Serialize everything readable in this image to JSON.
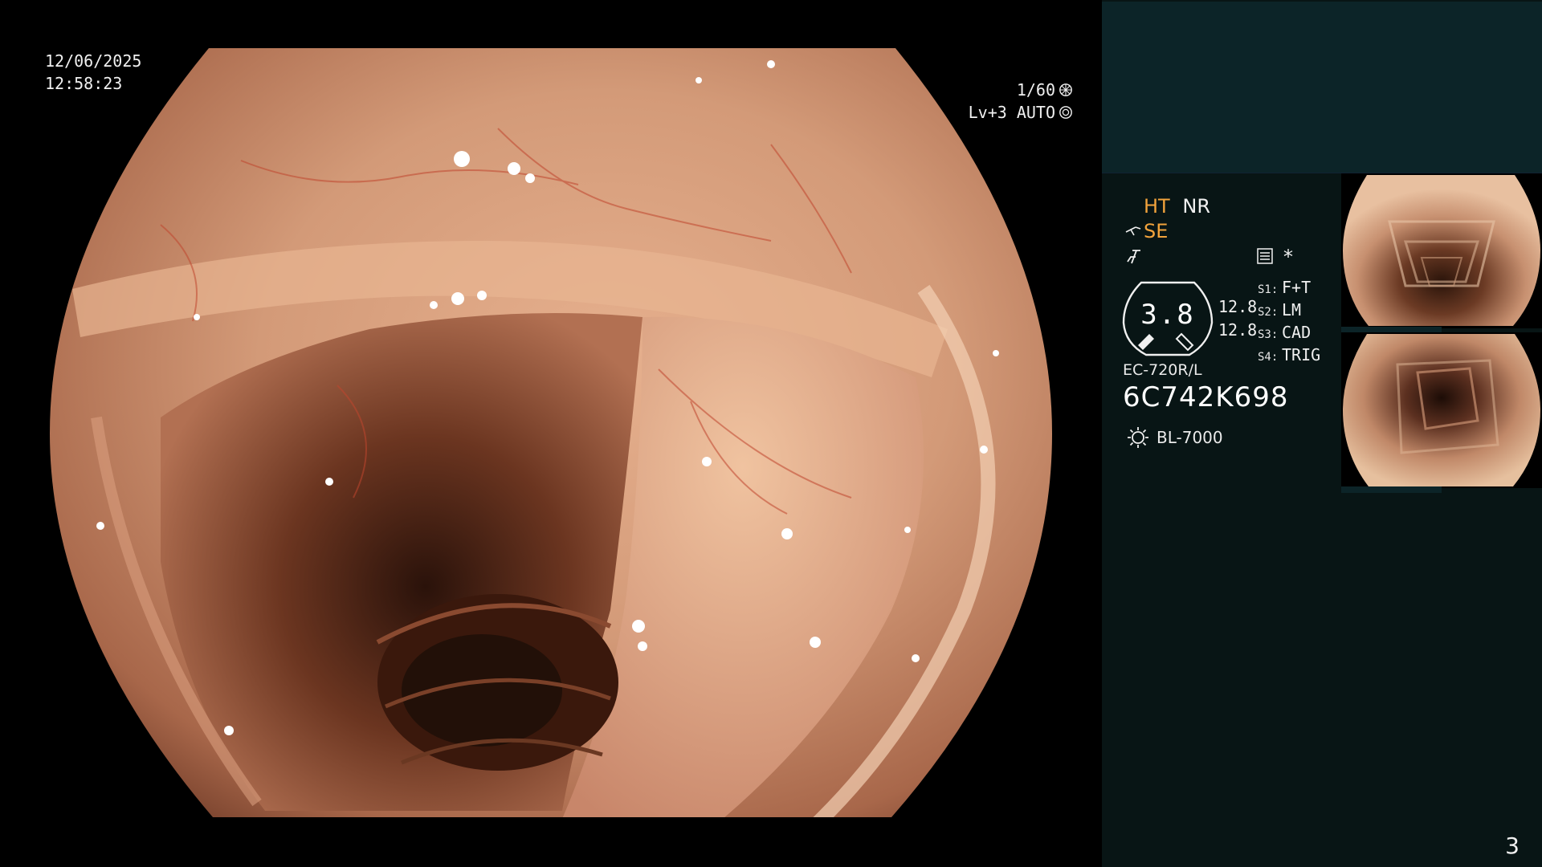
{
  "osd": {
    "date": "12/06/2025",
    "time": "12:58:23",
    "shutter": "1/60",
    "iris": "Lv+3 AUTO"
  },
  "panel": {
    "ht": "HT",
    "nr": "NR",
    "se": "SE",
    "star": "*",
    "gauge_value": "3.8",
    "gauge_side_top": "12.8",
    "gauge_side_bottom": "12.8",
    "switches": [
      {
        "key": "S1:",
        "value": "F+T"
      },
      {
        "key": "S2:",
        "value": "LM"
      },
      {
        "key": "S3:",
        "value": "CAD"
      },
      {
        "key": "S4:",
        "value": "TRIG"
      }
    ],
    "scope_model": "EC-720R/L",
    "scope_serial": "6C742K698",
    "light_source": "BL-7000",
    "icons": [
      "scope-tip-icon",
      "edge-enhance-icon",
      "menu-icon",
      "light-source-icon",
      "shutter-icon",
      "iris-icon"
    ]
  },
  "page_number": "3",
  "colors": {
    "panel_bg": "#081515",
    "panel_top": "#0c2428",
    "accent_orange": "#f2a33c",
    "tissue": "#c98a6a"
  }
}
